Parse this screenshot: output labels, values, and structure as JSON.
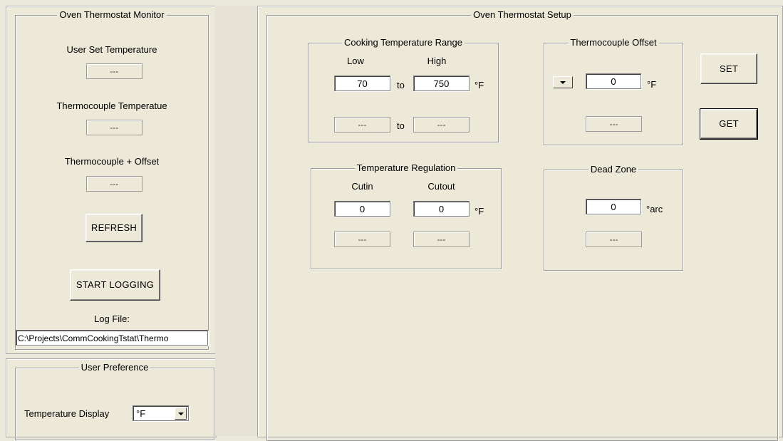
{
  "monitor": {
    "title": "Oven Thermostat Monitor",
    "user_set_label": "User Set Temperature",
    "user_set_value": "---",
    "thermo_label": "Thermocouple Temperatue",
    "thermo_value": "---",
    "thermo_offset_label": "Thermocouple + Offset",
    "thermo_offset_value": "---",
    "refresh_label": "REFRESH",
    "start_logging_label": "START LOGGING",
    "log_file_label": "Log File:",
    "log_file_path": "C:\\Projects\\CommCookingTstat\\Thermo"
  },
  "preference": {
    "title": "User Preference",
    "display_label": "Temperature Display",
    "display_value": "°F"
  },
  "setup": {
    "title": "Oven Thermostat Setup",
    "range": {
      "title": "Cooking Temperature Range",
      "low_label": "Low",
      "high_label": "High",
      "low_value": "70",
      "high_value": "750",
      "to_label": "to",
      "unit": "°F",
      "low_read": "---",
      "high_read": "---"
    },
    "offset": {
      "title": "Thermocouple Offset",
      "value": "0",
      "unit": "°F",
      "read": "---"
    },
    "regulation": {
      "title": "Temperature Regulation",
      "cutin_label": "Cutin",
      "cutout_label": "Cutout",
      "cutin_value": "0",
      "cutout_value": "0",
      "unit": "°F",
      "cutin_read": "---",
      "cutout_read": "---"
    },
    "deadzone": {
      "title": "Dead Zone",
      "value": "0",
      "unit": "°arc",
      "read": "---"
    },
    "set_label": "SET",
    "get_label": "GET"
  }
}
